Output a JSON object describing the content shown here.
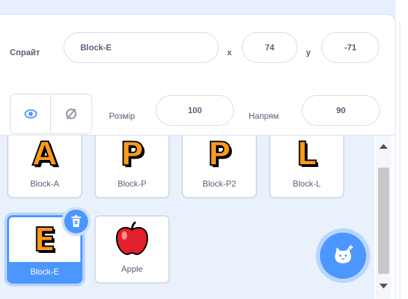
{
  "sprite_info": {
    "sprite_label": "Спрайт",
    "sprite_name": "Block-E",
    "x_label": "x",
    "x_value": "74",
    "y_label": "y",
    "y_value": "-71",
    "size_label": "Розмір",
    "size_value": "100",
    "direction_label": "Напрям",
    "direction_value": "90",
    "show_icon": "eye-icon",
    "hide_icon": "eye-slash-icon"
  },
  "sprites": [
    {
      "name": "Block-A",
      "glyph": "A",
      "selected": false
    },
    {
      "name": "Block-P",
      "glyph": "P",
      "selected": false
    },
    {
      "name": "Block-P2",
      "glyph": "P",
      "selected": false
    },
    {
      "name": "Block-L",
      "glyph": "L",
      "selected": false
    },
    {
      "name": "Block-E",
      "glyph": "E",
      "selected": true
    },
    {
      "name": "Apple",
      "glyph": "apple-icon",
      "selected": false
    }
  ],
  "colors": {
    "accent": "#4c97ff",
    "text": "#575e75",
    "letter_fill": "#ff9a1a",
    "apple": "#e0202b"
  }
}
